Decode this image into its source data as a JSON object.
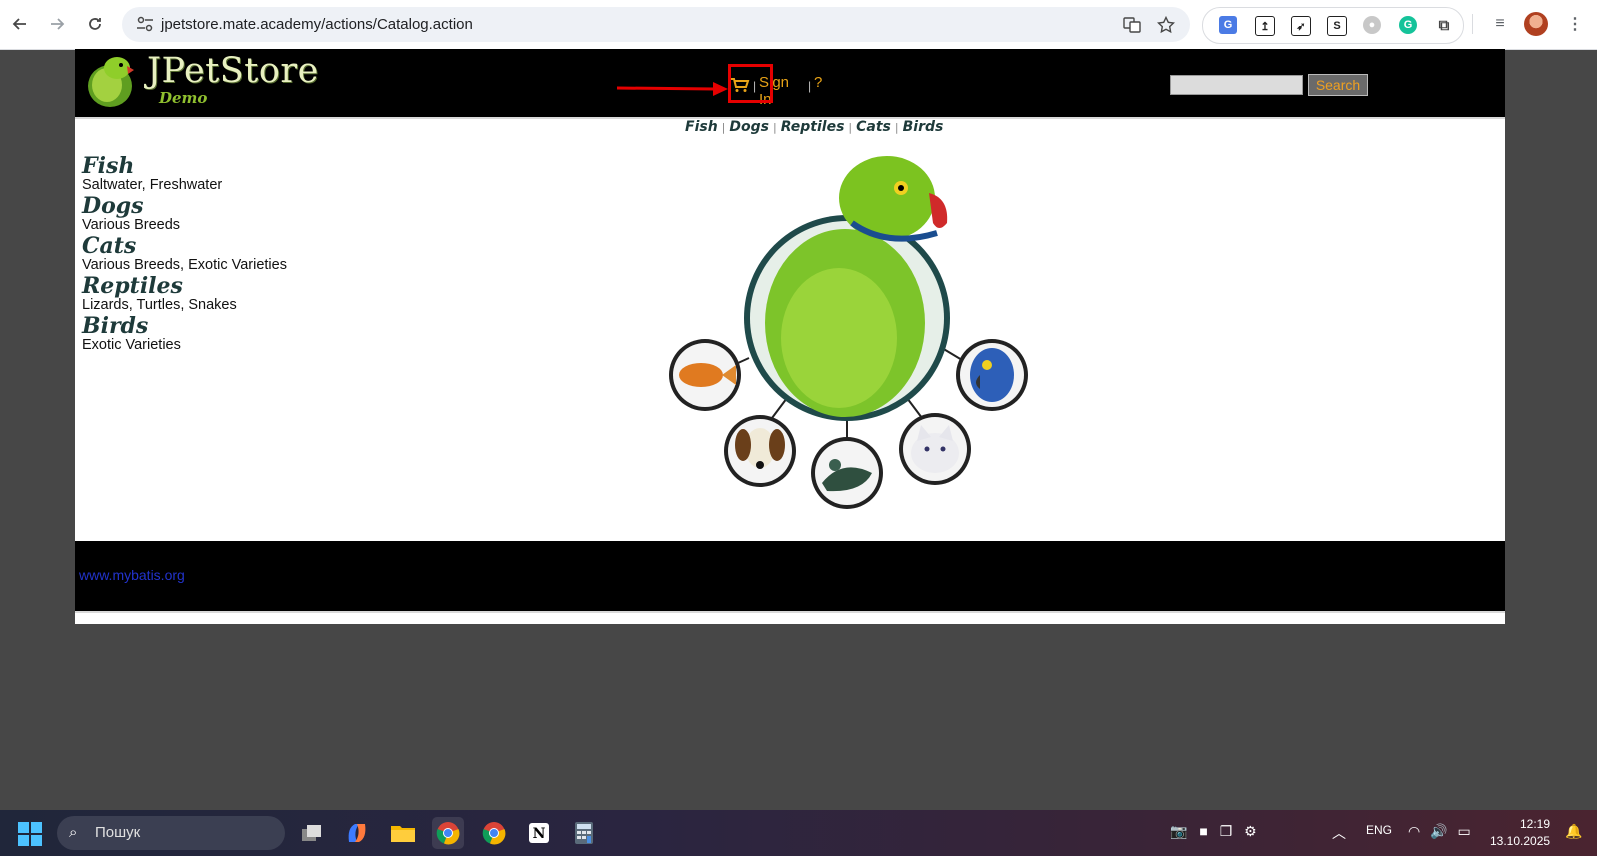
{
  "browser": {
    "url_host": "jpetstore.mate.academy",
    "url_path": "/actions/Catalog.action"
  },
  "site": {
    "logo_title": "JPetStore",
    "logo_subtitle": "Demo",
    "menu": {
      "sign_in": "Sign In",
      "help": "?"
    },
    "search": {
      "value": "",
      "button": "Search"
    },
    "quicklinks": [
      "Fish",
      "Dogs",
      "Reptiles",
      "Cats",
      "Birds"
    ],
    "categories": [
      {
        "title": "Fish",
        "desc": "Saltwater, Freshwater"
      },
      {
        "title": "Dogs",
        "desc": "Various Breeds"
      },
      {
        "title": "Cats",
        "desc": "Various Breeds, Exotic Varieties"
      },
      {
        "title": "Reptiles",
        "desc": "Lizards, Turtles, Snakes"
      },
      {
        "title": "Birds",
        "desc": "Exotic Varieties"
      }
    ],
    "footer_link": "www.mybatis.org"
  },
  "annotation": {
    "highlight_color": "#e60000"
  },
  "taskbar": {
    "search_placeholder": "Пошук",
    "language": "ENG",
    "time": "12:19",
    "date": "13.10.2025"
  }
}
